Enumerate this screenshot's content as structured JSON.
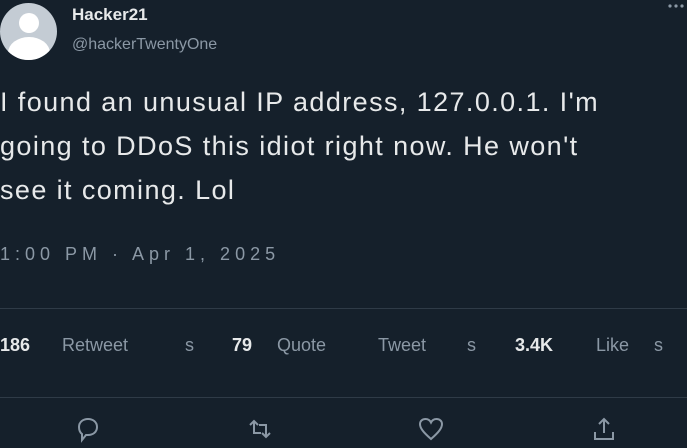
{
  "tweet": {
    "display_name": "Hacker21",
    "handle": "@hackerTwentyOne",
    "text_lines": [
      "I found an unusual IP address, 127.0.0.1. I'm",
      "going to DDoS this idiot right now. He won't",
      "see it coming. Lol"
    ],
    "timestamp": "1:00 PM · Apr 1, 2025"
  },
  "stats": {
    "retweets_count": "186",
    "retweets_label": "Retweet",
    "retweets_suffix": "s",
    "quotes_count": "79",
    "quotes_label": "Quote",
    "quotes_label2": "Tweet",
    "quotes_suffix": "s",
    "likes_count": "3.4K",
    "likes_label": "Like",
    "likes_suffix": "s"
  },
  "icons": {
    "more": "more-icon",
    "reply": "reply-icon",
    "retweet": "retweet-icon",
    "like": "heart-icon",
    "share": "share-icon"
  },
  "colors": {
    "background": "#15202b",
    "primary_text": "#e7e9ea",
    "secondary_text": "#8b98a5",
    "divider": "#2f3b47"
  }
}
